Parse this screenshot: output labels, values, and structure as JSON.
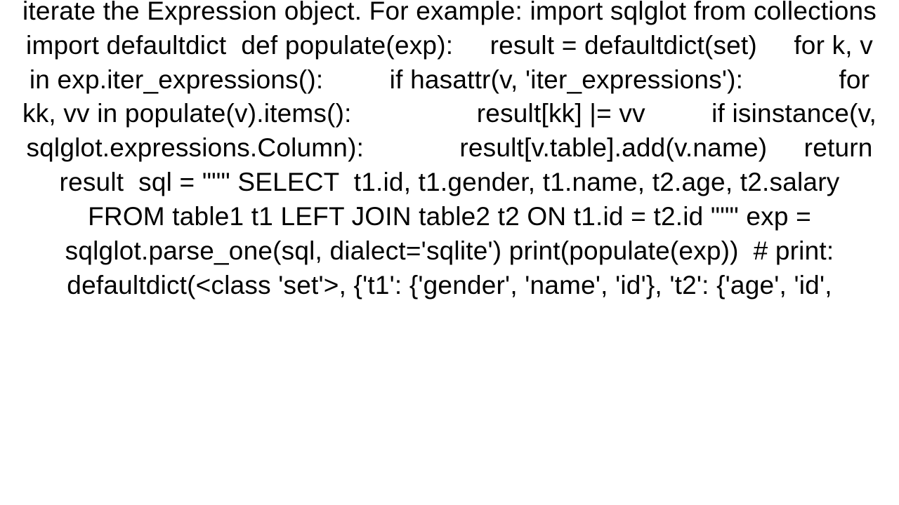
{
  "body_text": "iterate the Expression object. For example: import sqlglot from collections import defaultdict  def populate(exp):     result = defaultdict(set)     for k, v in exp.iter_expressions():         if hasattr(v, 'iter_expressions'):             for kk, vv in populate(v).items():                 result[kk] |= vv         if isinstance(v, sqlglot.expressions.Column):             result[v.table].add(v.name)     return result  sql = \"\"\" SELECT  t1.id, t1.gender, t1.name, t2.age, t2.salary FROM table1 t1 LEFT JOIN table2 t2 ON t1.id = t2.id \"\"\" exp = sqlglot.parse_one(sql, dialect='sqlite') print(populate(exp))  # print: defaultdict(<class 'set'>, {'t1': {'gender', 'name', 'id'}, 't2': {'age', 'id',"
}
